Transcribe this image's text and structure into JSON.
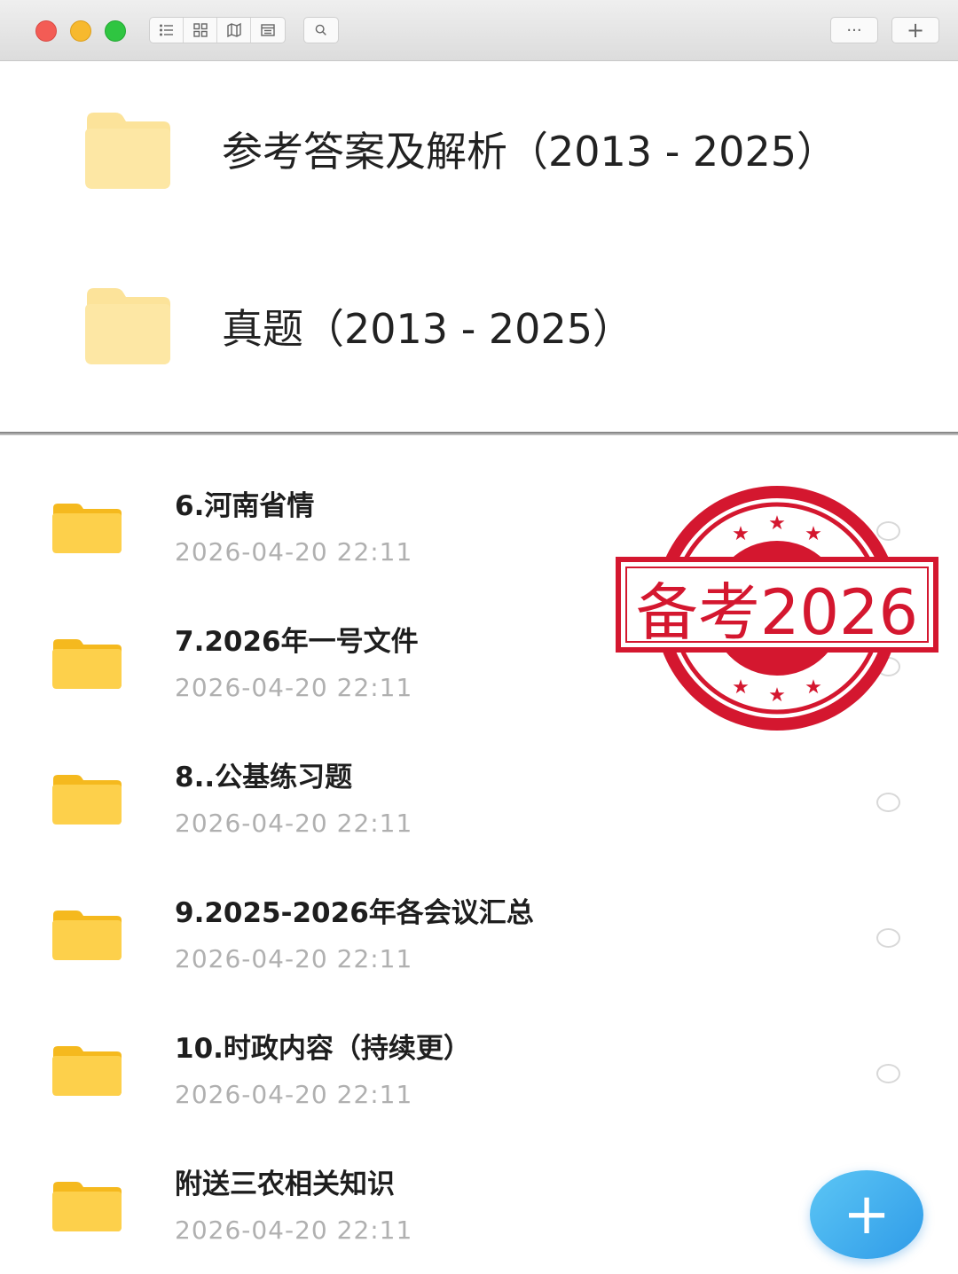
{
  "toolbar": {
    "view_buttons": [
      "list-view-icon",
      "grid-view-icon",
      "map-view-icon",
      "calendar-view-icon"
    ],
    "search_icon": "search-icon",
    "more_label": "···",
    "add_label": "+"
  },
  "top_folders": [
    {
      "label": "参考答案及解析（2013 - 2025）"
    },
    {
      "label": "真题（2013 - 2025）"
    }
  ],
  "items": [
    {
      "title": "6.河南省情",
      "date": "2026-04-20  22:11"
    },
    {
      "title": "7.2026年一号文件",
      "date": "2026-04-20  22:11"
    },
    {
      "title": "8..公基练习题",
      "date": "2026-04-20  22:11"
    },
    {
      "title": "9.2025-2026年各会议汇总",
      "date": "2026-04-20  22:11"
    },
    {
      "title": "10.时政内容（持续更）",
      "date": "2026-04-20  22:11"
    },
    {
      "title": "附送三农相关知识",
      "date": "2026-04-20  22:11"
    }
  ],
  "stamp": {
    "text": "备考2026"
  },
  "fab": {
    "label": "+"
  },
  "colors": {
    "folder": "#fcd45a",
    "stamp": "#d4172f",
    "fab": "#3aa6ec"
  }
}
